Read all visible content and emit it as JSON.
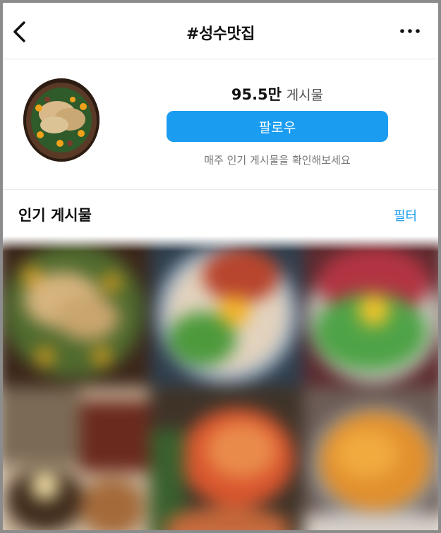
{
  "header": {
    "title": "#성수맛집",
    "back_icon": "chevron-left-icon",
    "more_icon": "ellipsis-icon"
  },
  "hashtag": {
    "post_count": "95.5만",
    "post_unit": "게시물",
    "follow_label": "팔로우",
    "hint": "매주 인기 게시물을 확인해보세요"
  },
  "section": {
    "title": "인기 게시물",
    "filter_label": "필터"
  },
  "colors": {
    "accent": "#1a9cf0",
    "background": "#ffffff"
  }
}
